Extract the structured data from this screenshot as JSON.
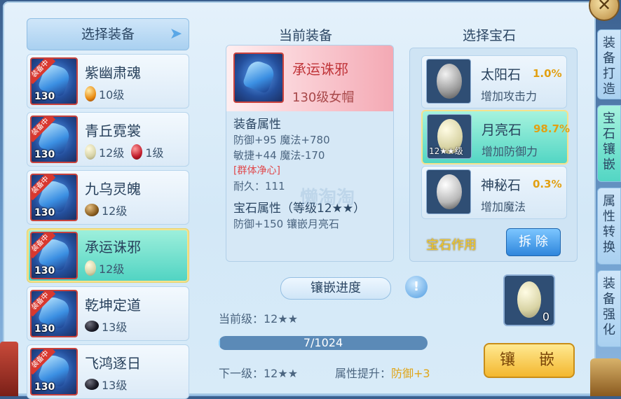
{
  "left_header": "选择装备",
  "equipment": [
    {
      "badge": "装备中",
      "level": "130",
      "name": "紫幽肃魂",
      "gems": [
        {
          "type": "orange",
          "text": "10级"
        }
      ]
    },
    {
      "badge": "装备中",
      "level": "130",
      "name": "青丘霓裳",
      "gems": [
        {
          "type": "moon",
          "text": "12级"
        },
        {
          "type": "red",
          "text": "1级"
        }
      ]
    },
    {
      "badge": "装备中",
      "level": "130",
      "name": "九乌灵魄",
      "gems": [
        {
          "type": "brown",
          "text": "12级"
        }
      ]
    },
    {
      "badge": "装备中",
      "level": "130",
      "name": "承运诛邪",
      "gems": [
        {
          "type": "moon",
          "text": "12级"
        }
      ],
      "selected": true
    },
    {
      "badge": "装备中",
      "level": "130",
      "name": "乾坤定道",
      "gems": [
        {
          "type": "black",
          "text": "13级"
        }
      ]
    },
    {
      "badge": "装备中",
      "level": "130",
      "name": "飞鸿逐日",
      "gems": [
        {
          "type": "black",
          "text": "13级"
        }
      ]
    }
  ],
  "current": {
    "title": "当前装备",
    "name": "承运诛邪",
    "subtitle": "130级女帽",
    "attr_title": "装备属性",
    "attr_line1": "防御+95 魔法+780",
    "attr_line2": "敏捷+44 魔法-170",
    "special": "[群体净心]",
    "durability": "耐久：111",
    "gem_attr_title": "宝石属性（等级12★★）",
    "gem_attr_line": "防御+150 镶嵌月亮石"
  },
  "watermark": "懒淘淘",
  "inlay": {
    "label": "镶嵌进度",
    "current_level": "当前级：12★★",
    "progress_text": "7/1024",
    "progress_fraction": 0.0068,
    "next_level": "下一级：12★★",
    "attr_up_label": "属性提升：",
    "attr_up_value": "防御+3",
    "button": "镶　嵌"
  },
  "gems": {
    "title": "选择宝石",
    "items": [
      {
        "name": "太阳石",
        "rate": "1.0%",
        "desc": "增加攻击力",
        "type": "sun"
      },
      {
        "name": "月亮石",
        "rate": "98.7%",
        "desc": "增加防御力",
        "type": "moon",
        "tag": "12★★级",
        "selected": true
      },
      {
        "name": "神秘石",
        "rate": "0.3%",
        "desc": "增加魔法",
        "type": "myst"
      }
    ],
    "effect_label": "宝石作用",
    "remove_button": "拆 除",
    "slot_count": "0"
  },
  "side_tabs": [
    "装备打造",
    "宝石镶嵌",
    "属性转换",
    "装备强化"
  ]
}
